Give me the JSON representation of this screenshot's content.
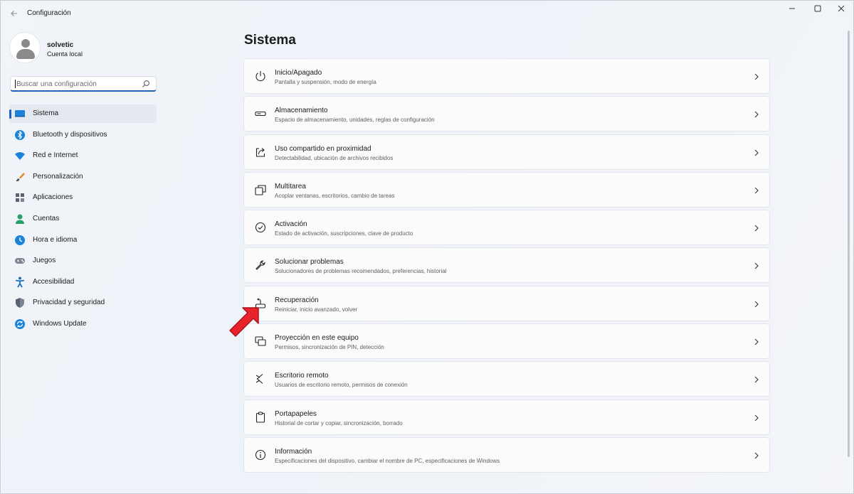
{
  "window": {
    "title": "Configuración",
    "controls": {
      "minimize": "—",
      "maximize": "☐",
      "close": "✕"
    }
  },
  "profile": {
    "name": "solvetic",
    "account_type": "Cuenta local"
  },
  "search": {
    "placeholder": "Buscar una configuración",
    "icon": "search-icon"
  },
  "nav": {
    "items": [
      {
        "label": "Sistema",
        "icon": "monitor-icon",
        "active": true
      },
      {
        "label": "Bluetooth y dispositivos",
        "icon": "bluetooth-icon"
      },
      {
        "label": "Red e Internet",
        "icon": "wifi-icon"
      },
      {
        "label": "Personalización",
        "icon": "brush-icon"
      },
      {
        "label": "Aplicaciones",
        "icon": "apps-icon"
      },
      {
        "label": "Cuentas",
        "icon": "person-icon"
      },
      {
        "label": "Hora e idioma",
        "icon": "clock-globe-icon"
      },
      {
        "label": "Juegos",
        "icon": "gamepad-icon"
      },
      {
        "label": "Accesibilidad",
        "icon": "accessibility-icon"
      },
      {
        "label": "Privacidad y seguridad",
        "icon": "shield-icon"
      },
      {
        "label": "Windows Update",
        "icon": "refresh-icon"
      }
    ]
  },
  "main": {
    "title": "Sistema",
    "items": [
      {
        "title": "Inicio/Apagado",
        "subtitle": "Pantalla y suspensión, modo de energía",
        "icon": "power-icon"
      },
      {
        "title": "Almacenamiento",
        "subtitle": "Espacio de almacenamiento, unidades, reglas de configuración",
        "icon": "storage-icon"
      },
      {
        "title": "Uso compartido en proximidad",
        "subtitle": "Detectabilidad, ubicación de archivos recibidos",
        "icon": "share-icon"
      },
      {
        "title": "Multitarea",
        "subtitle": "Acoplar ventanas, escritorios, cambio de tareas",
        "icon": "multitask-icon"
      },
      {
        "title": "Activación",
        "subtitle": "Estado de activación, suscripciones, clave de producto",
        "icon": "check-circle-icon"
      },
      {
        "title": "Solucionar problemas",
        "subtitle": "Solucionadores de problemas recomendados, preferencias, historial",
        "icon": "wrench-icon"
      },
      {
        "title": "Recuperación",
        "subtitle": "Reiniciar, inicio avanzado, volver",
        "icon": "recovery-icon"
      },
      {
        "title": "Proyección en este equipo",
        "subtitle": "Permisos, sincronización de PIN, detección",
        "icon": "projection-icon"
      },
      {
        "title": "Escritorio remoto",
        "subtitle": "Usuarios de escritorio remoto, permisos de conexión",
        "icon": "remote-desktop-icon"
      },
      {
        "title": "Portapapeles",
        "subtitle": "Historial de cortar y copiar, sincronización, borrado",
        "icon": "clipboard-icon"
      },
      {
        "title": "Información",
        "subtitle": "Especificaciones del dispositivo, cambiar el nombre de PC, especificaciones de Windows",
        "icon": "info-icon"
      }
    ]
  },
  "annotation": {
    "arrow_color": "#e8232b",
    "target": "Recuperación"
  },
  "colors": {
    "accent": "#1f63c2",
    "background": "#eef2f8",
    "card": "#fbfbfc"
  }
}
